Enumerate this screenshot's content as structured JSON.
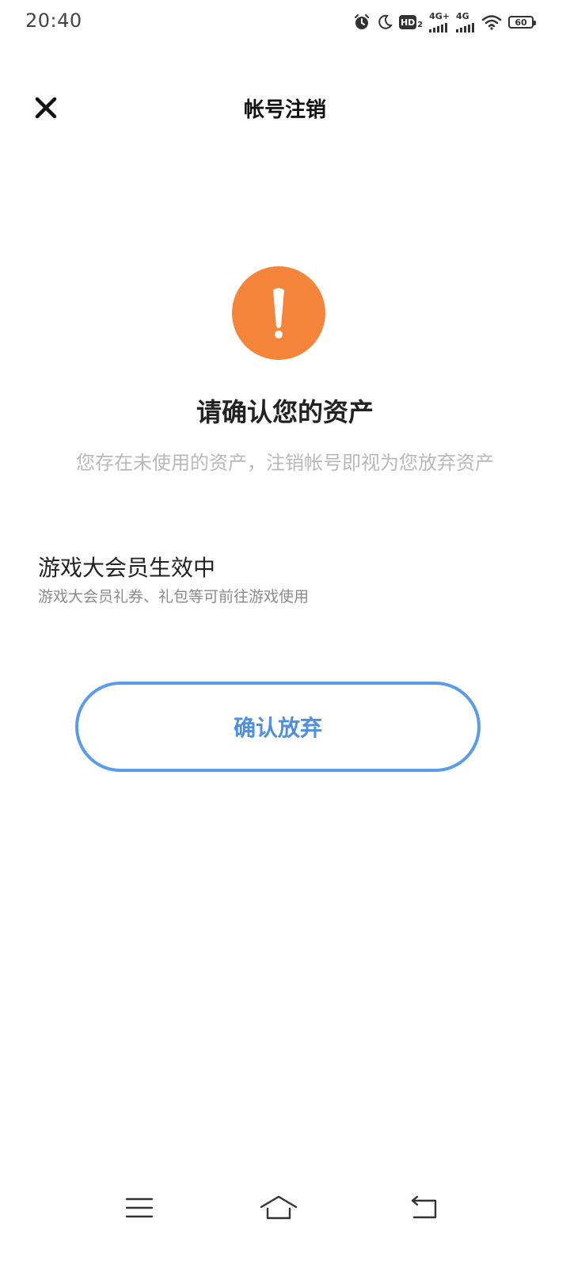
{
  "status_bar": {
    "time": "20:40",
    "icons": [
      "alarm-icon",
      "moon-icon",
      "hd-icon",
      "signal-icon",
      "signal-icon",
      "wifi-icon",
      "battery-icon"
    ],
    "hd_label": "HD",
    "hd_sub": "2",
    "signal1_label": "4G+",
    "signal2_label": "4G",
    "battery_level": "60"
  },
  "header": {
    "title": "帐号注销",
    "close_icon": "close-icon"
  },
  "warning": {
    "icon": "exclamation-icon",
    "icon_color": "#f4843a",
    "title": "请确认您的资产",
    "description": "您存在未使用的资产，注销帐号即视为您放弃资产"
  },
  "asset": {
    "title": "游戏大会员生效中",
    "description": "游戏大会员礼券、礼包等可前往游戏使用"
  },
  "confirm": {
    "label": "确认放弃",
    "color": "#5b9be8"
  },
  "nav_bar": {
    "icons": [
      "menu-icon",
      "home-icon",
      "back-icon"
    ]
  }
}
